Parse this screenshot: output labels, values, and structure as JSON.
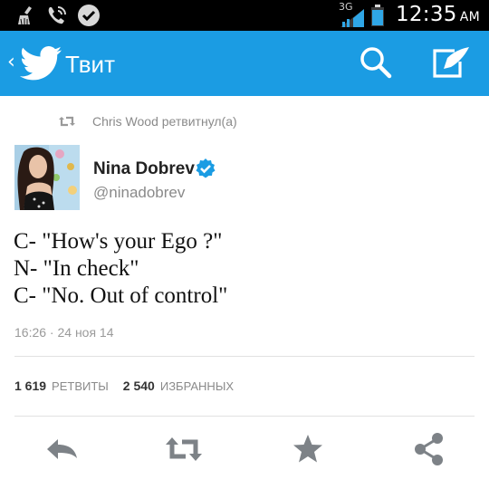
{
  "status_bar": {
    "network": "3G",
    "time": "12:35",
    "ampm": "AM",
    "icons": [
      "cleaner-icon",
      "phone-icon",
      "check-circle-icon",
      "signal-icon",
      "battery-icon"
    ]
  },
  "action_bar": {
    "title": "Твит",
    "back_glyph": "‹",
    "bg_color": "#1b9ce3",
    "icons": [
      "twitter-bird-icon",
      "search-icon",
      "compose-icon"
    ]
  },
  "tweet": {
    "retweeted_by": "Chris Wood ретвитнул(а)",
    "author_name": "Nina Dobrev",
    "author_handle": "@ninadobrev",
    "verified": true,
    "lines": [
      "C- \"How's your Ego ?\"",
      "N- \"In check\"",
      "C- \"No. Out of control\""
    ],
    "timestamp": "16:26 · 24 ноя 14",
    "retweets_count": "1 619",
    "retweets_label": "РЕТВИТЫ",
    "favorites_count": "2 540",
    "favorites_label": "ИЗБРАННЫХ"
  },
  "actions": [
    "reply-icon",
    "retweet-icon",
    "favorite-icon",
    "share-icon"
  ]
}
